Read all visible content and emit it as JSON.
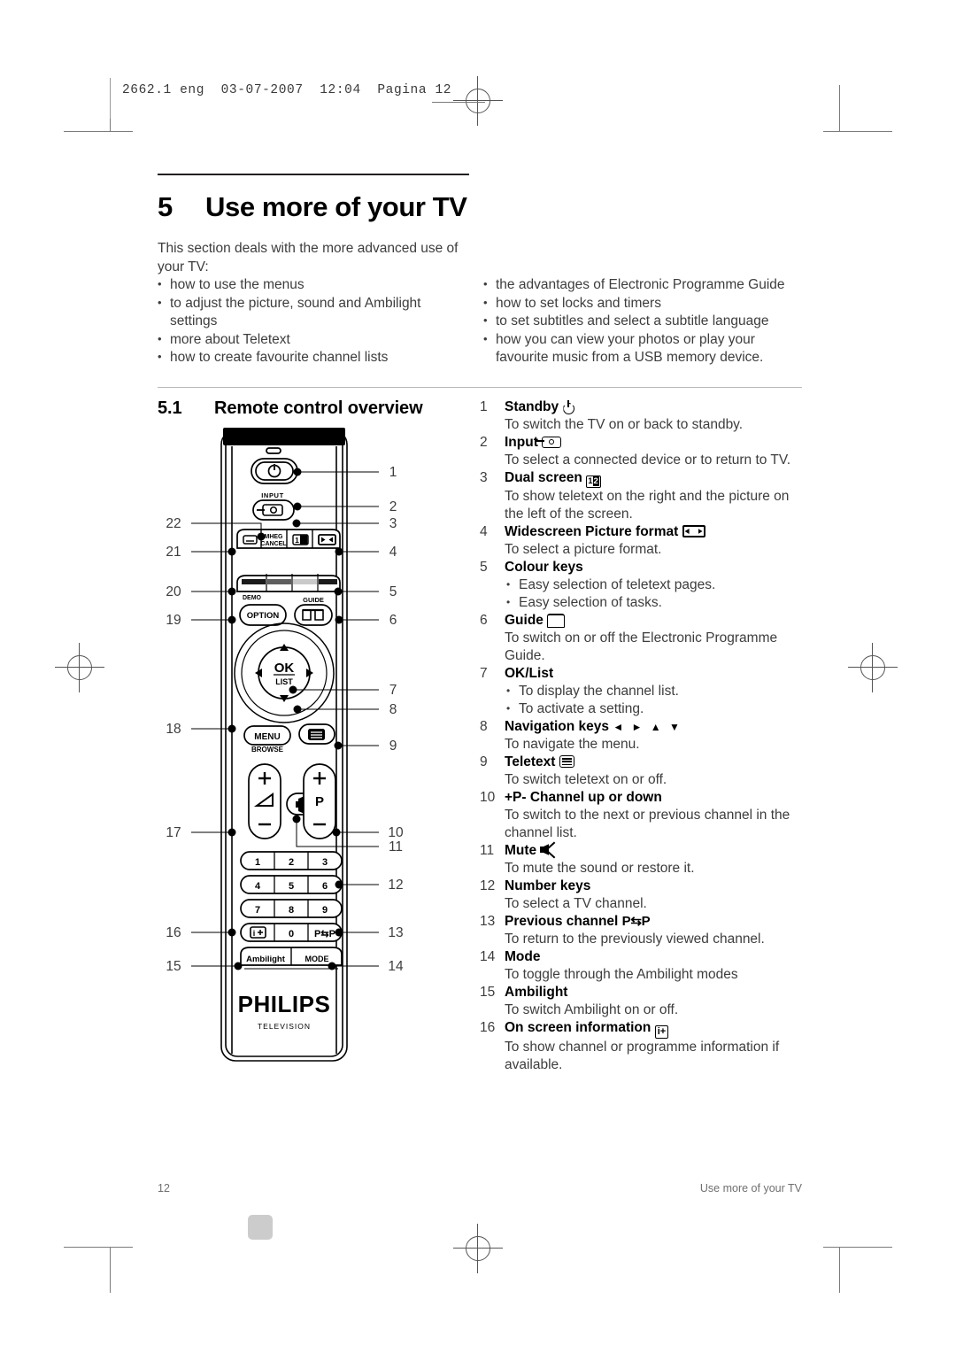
{
  "slug": {
    "text": "2662.1 eng  03-07-2007  12:04  Pagina 12"
  },
  "chapter": {
    "number": "5",
    "title": "Use more of your TV"
  },
  "intro": {
    "paragraph": "This section deals with the more advanced use of your TV:",
    "left_bullets": [
      "how to use the menus",
      "to adjust the picture, sound and Ambilight settings",
      "more about Teletext",
      "how to create favourite channel lists"
    ],
    "right_bullets": [
      "the advantages of Electronic Programme Guide",
      "how to set locks and timers",
      "to set subtitles and select a subtitle language",
      "how you can view your photos or play your favourite music from a USB memory device."
    ]
  },
  "section": {
    "number": "5.1",
    "title": "Remote control overview"
  },
  "legend": [
    {
      "n": "1",
      "term": "Standby",
      "icon": "power-icon",
      "lines": [
        "To switch the TV on or back to standby."
      ]
    },
    {
      "n": "2",
      "term": "Input",
      "icon": "input-icon",
      "lines": [
        "To select a connected device or to return to TV."
      ]
    },
    {
      "n": "3",
      "term": "Dual screen",
      "icon": "dual-screen-icon",
      "lines": [
        "To show teletext on the right and the picture on the left of the screen."
      ]
    },
    {
      "n": "4",
      "term": "Widescreen Picture format",
      "icon": "widescreen-icon",
      "lines": [
        "To select a picture format."
      ]
    },
    {
      "n": "5",
      "term": "Colour keys",
      "icon": "",
      "sub": [
        "Easy selection of teletext pages.",
        "Easy selection of tasks."
      ]
    },
    {
      "n": "6",
      "term": "Guide",
      "icon": "guide-icon",
      "lines": [
        "To switch on or off the Electronic Programme Guide."
      ]
    },
    {
      "n": "7",
      "term": "OK/List",
      "icon": "",
      "sub": [
        "To display the channel list.",
        "To activate a setting."
      ]
    },
    {
      "n": "8",
      "term": "Navigation keys",
      "icon": "navigation-arrows-icon",
      "icon_text": "◄ ► ▲ ▼",
      "lines": [
        "To navigate the menu."
      ]
    },
    {
      "n": "9",
      "term": "Teletext",
      "icon": "teletext-icon",
      "lines": [
        "To switch teletext on or off."
      ]
    },
    {
      "n": "10",
      "term": "+P-  Channel up or down",
      "icon": "",
      "lines": [
        "To switch to the next or previous channel in the channel list."
      ]
    },
    {
      "n": "11",
      "term": "Mute",
      "icon": "mute-icon",
      "lines": [
        "To mute the sound or restore it."
      ]
    },
    {
      "n": "12",
      "term": "Number keys",
      "icon": "",
      "lines": [
        "To select a TV channel."
      ]
    },
    {
      "n": "13",
      "term": "Previous channel",
      "icon": "previous-channel-icon",
      "icon_text": "P⇆P",
      "lines": [
        "To return to the previously viewed channel."
      ]
    },
    {
      "n": "14",
      "term": "Mode",
      "icon": "",
      "lines": [
        "To toggle through the Ambilight modes"
      ]
    },
    {
      "n": "15",
      "term": "Ambilight",
      "icon": "",
      "lines": [
        "To switch Ambilight on or off."
      ]
    },
    {
      "n": "16",
      "term": "On screen information",
      "icon": "on-screen-info-icon",
      "icon_text": "i+",
      "lines": [
        "To show channel or programme information if available."
      ]
    }
  ],
  "remote": {
    "brand": "PHILIPS",
    "brand_sub": "TELEVISION",
    "buttons": {
      "input_label": "INPUT",
      "mheg": "MHEG",
      "cancel": "CANCEL",
      "dual": "12",
      "demo": "DEMO",
      "option": "OPTION",
      "guide_label": "GUIDE",
      "ok": "OK",
      "list": "LIST",
      "menu": "MENU",
      "browse": "BROWSE",
      "p": "P",
      "ambilight": "Ambilight",
      "mode": "MODE",
      "pp": "P⇆P",
      "zero": "0",
      "keypad": [
        "1",
        "2",
        "3",
        "4",
        "5",
        "6",
        "7",
        "8",
        "9"
      ]
    },
    "callouts": [
      "1",
      "2",
      "3",
      "4",
      "5",
      "6",
      "7",
      "8",
      "9",
      "10",
      "11",
      "12",
      "13",
      "14",
      "15",
      "16",
      "17",
      "18",
      "19",
      "20",
      "21",
      "22"
    ],
    "colour_keys": [
      "#1a1a1a",
      "#5e5e5e",
      "#c9c9c9",
      "#1a1a1a"
    ]
  },
  "footer": {
    "page": "12",
    "running_title": "Use more of your TV"
  }
}
